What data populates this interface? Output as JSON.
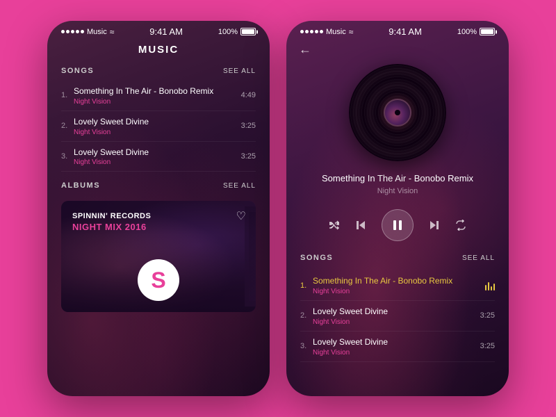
{
  "left_phone": {
    "status": {
      "app": "Music",
      "time": "9:41 AM",
      "battery": "100%"
    },
    "header": "MUSIC",
    "songs_section": {
      "title": "SONGS",
      "see_all": "SEE ALL",
      "items": [
        {
          "number": "1.",
          "title": "Something In The Air - Bonobo Remix",
          "artist": "Night Vision",
          "duration": "4:49"
        },
        {
          "number": "2.",
          "title": "Lovely Sweet Divine",
          "artist": "Night Vision",
          "duration": "3:25"
        },
        {
          "number": "3.",
          "title": "Lovely Sweet Divine",
          "artist": "Night Vision",
          "duration": "3:25"
        }
      ]
    },
    "albums_section": {
      "title": "ALBUMS",
      "see_all": "SEE ALL",
      "album": {
        "label": "SPINNIN' RECORDS",
        "title": "NIGHT MIX 2016"
      }
    }
  },
  "right_phone": {
    "status": {
      "app": "Music",
      "time": "9:41 AM",
      "battery": "100%"
    },
    "back_label": "←",
    "track": {
      "title": "Something In The Air - Bonobo Remix",
      "artist": "Night Vision"
    },
    "controls": {
      "shuffle": "⇄",
      "prev": "⏮",
      "play_pause": "⏸",
      "next": "⏭",
      "repeat": "↩"
    },
    "songs_section": {
      "title": "SONGS",
      "see_all": "SEE ALL",
      "items": [
        {
          "number": "1.",
          "title": "Something In The Air - Bonobo Remix",
          "artist": "Night Vision",
          "duration": "",
          "active": true
        },
        {
          "number": "2.",
          "title": "Lovely Sweet Divine",
          "artist": "Night Vision",
          "duration": "3:25",
          "active": false
        },
        {
          "number": "3.",
          "title": "Lovely Sweet Divine",
          "artist": "Night Vision",
          "duration": "3:25",
          "active": false
        }
      ]
    }
  }
}
